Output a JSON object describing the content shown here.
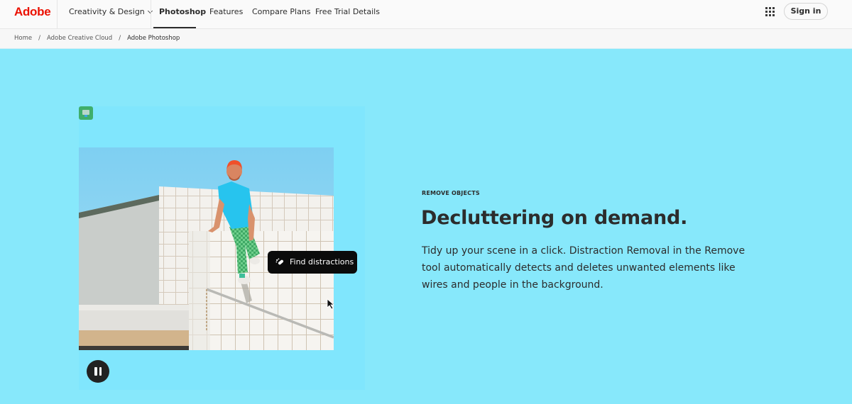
{
  "nav": {
    "brand": "Adobe",
    "items": [
      {
        "label": "Creativity & Design",
        "has_dropdown": true
      },
      {
        "label": "Photoshop",
        "active": true
      },
      {
        "label": "Features"
      },
      {
        "label": "Compare Plans"
      },
      {
        "label": "Free Trial Details"
      }
    ],
    "apps_icon": "grid-apps-icon",
    "sign_in": "Sign in"
  },
  "breadcrumb": [
    "Home",
    "Adobe Creative Cloud",
    "Adobe Photoshop"
  ],
  "media": {
    "badge_icon": "app-badge-icon",
    "tooltip_label": "Find distractions",
    "tooltip_icon": "bandage-icon",
    "pause_icon": "pause-icon",
    "cursor_icon": "pointer-cursor-icon"
  },
  "section": {
    "eyebrow": "REMOVE OBJECTS",
    "headline": "Decluttering on demand.",
    "body": "Tidy up your scene in a click. Distraction Removal in the Remove tool automatically detects and deletes unwanted elements like wires and people in the background."
  },
  "colors": {
    "brand_red": "#eb1000",
    "page_bg": "#87e8fb",
    "panel_bg": "#80e6fd",
    "badge_green": "#3fae6b",
    "tooltip_bg": "#0b0b0b"
  }
}
